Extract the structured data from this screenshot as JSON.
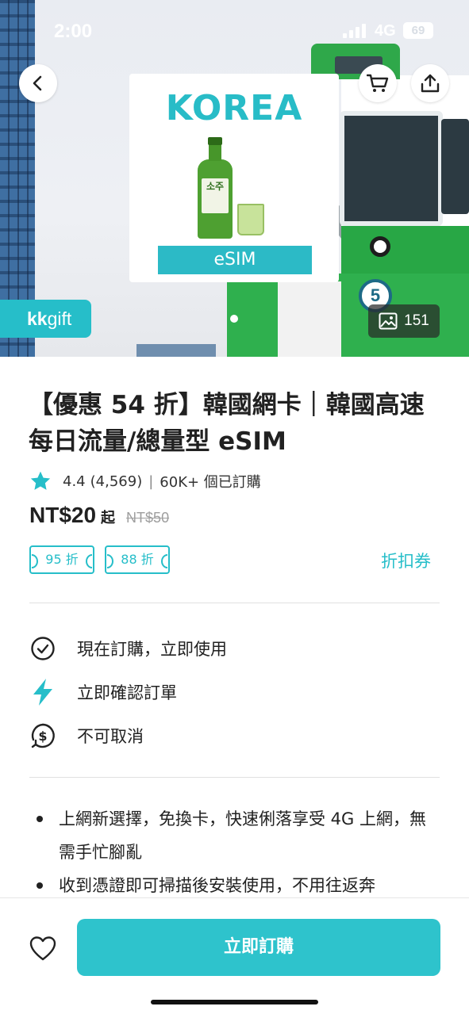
{
  "status_bar": {
    "time": "2:00",
    "network": "4G",
    "battery": "69"
  },
  "hero": {
    "product_card": {
      "title": "KOREA",
      "bottle_label": "소주",
      "badge": "eSIM"
    },
    "photo_count": "151",
    "brand_tag": {
      "kk": "kk",
      "gift": "gift"
    }
  },
  "product": {
    "title": "【優惠 54 折】韓國網卡｜韓國高速每日流量/總量型 eSIM",
    "rating": "4.4",
    "reviews": "(4,569)",
    "separator": "|",
    "booked": "60K+ 個已訂購",
    "price": "NT$20",
    "price_suffix": "起",
    "original_price": "NT$50",
    "coupons": [
      "95 折",
      "88 折"
    ],
    "coupon_link": "折扣券"
  },
  "features": [
    {
      "icon": "check-circle-icon",
      "label": "現在訂購，立即使用"
    },
    {
      "icon": "lightning-icon",
      "label": "立即確認訂單"
    },
    {
      "icon": "no-refund-icon",
      "label": "不可取消"
    }
  ],
  "highlights": [
    "上網新選擇，免換卡，快速俐落享受 4G 上網，無需手忙腳亂",
    "收到憑證即可掃描後安裝使用，不用往返奔"
  ],
  "bottom": {
    "buy_label": "立即訂購"
  },
  "colors": {
    "accent": "#26bec9",
    "button": "#2ec3cc",
    "text": "#212121",
    "muted": "#9e9e9e"
  }
}
